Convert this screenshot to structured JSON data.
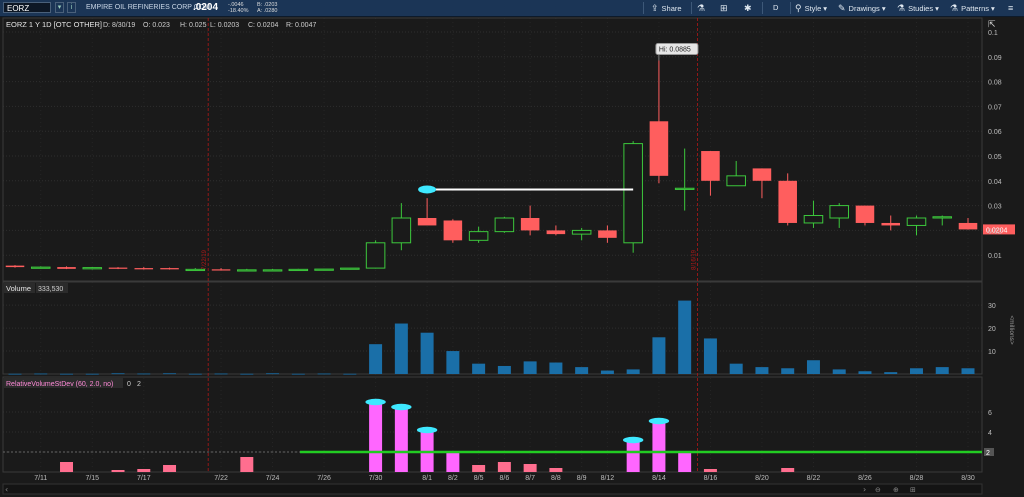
{
  "toolbar": {
    "symbol": "EORZ",
    "company": "EMPIRE OIL REFINERIES CORP COM",
    "last": ".0204",
    "change": "-.0046",
    "change_pct": "-18.40%",
    "bid": "B: .0203",
    "ask": "A: .0280",
    "share_label": "Share",
    "aggregation": "D",
    "style_label": "Style",
    "drawings_label": "Drawings",
    "studies_label": "Studies",
    "patterns_label": "Patterns",
    "icons": [
      "dropdown-icon",
      "info-icon",
      "export-icon",
      "flask-icon",
      "gear-icon",
      "pencil-icon",
      "pin-icon",
      "menu-icon"
    ]
  },
  "ohlc_bar": {
    "title": "EORZ 1 Y 1D [OTC OTHER]",
    "date": "D: 8/30/19",
    "open": "O: 0.023",
    "high": "H: 0.025",
    "low": "L: 0.0203",
    "close": "C: 0.0204",
    "range": "R: 0.0047"
  },
  "price_panel": {
    "hi_label": "Hi: 0.0885",
    "price_tag": "0.0204",
    "axis_ticks": [
      "0.1",
      "0.09",
      "0.08",
      "0.07",
      "0.06",
      "0.05",
      "0.04",
      "0.03",
      "0.02",
      "0.01"
    ],
    "event_markers": [
      "7/22/19",
      "8/16/19"
    ]
  },
  "volume_panel": {
    "label": "Volume",
    "value": "333,530",
    "axis_ticks": [
      "30",
      "20",
      "10"
    ],
    "unit": "<millions>"
  },
  "study_panel": {
    "label": "RelativeVolumeStDev (60, 2.0, no)",
    "value1": "0",
    "value2": "2",
    "axis_ticks": [
      "6",
      "4",
      "2"
    ],
    "level_tag": "2"
  },
  "x_axis": [
    "7/11",
    "7/15",
    "7/17",
    "7/22",
    "7/24",
    "7/26",
    "7/30",
    "8/1",
    "8/2",
    "8/5",
    "8/6",
    "8/7",
    "8/8",
    "8/9",
    "8/12",
    "8/14",
    "8/16",
    "8/20",
    "8/22",
    "8/26",
    "8/28",
    "8/30"
  ],
  "colors": {
    "up": "#3cc83c",
    "down": "#ff5e5e",
    "volume": "#1a6fa8",
    "rvsd": "#ff66ff",
    "level": "#22cc22",
    "highlight": "#3ee8ff"
  },
  "chart_data": {
    "type": "candlestick",
    "dates": [
      "7/10",
      "7/11",
      "7/12",
      "7/15",
      "7/16",
      "7/17",
      "7/18",
      "7/19",
      "7/22",
      "7/23",
      "7/24",
      "7/25",
      "7/26",
      "7/29",
      "7/30",
      "7/31",
      "8/1",
      "8/2",
      "8/5",
      "8/6",
      "8/7",
      "8/8",
      "8/9",
      "8/12",
      "8/13",
      "8/14",
      "8/15",
      "8/16",
      "8/19",
      "8/20",
      "8/21",
      "8/22",
      "8/23",
      "8/26",
      "8/27",
      "8/28",
      "8/29",
      "8/30"
    ],
    "open": [
      0.0058,
      0.0052,
      0.0052,
      0.0045,
      0.005,
      0.0048,
      0.0048,
      0.0043,
      0.0043,
      0.0041,
      0.0041,
      0.0041,
      0.0043,
      0.0044,
      0.0048,
      0.015,
      0.025,
      0.024,
      0.016,
      0.0195,
      0.025,
      0.02,
      0.0185,
      0.02,
      0.015,
      0.064,
      0.037,
      0.052,
      0.038,
      0.045,
      0.04,
      0.023,
      0.025,
      0.03,
      0.023,
      0.022,
      0.025,
      0.023
    ],
    "high": [
      0.006,
      0.0055,
      0.0055,
      0.0052,
      0.0052,
      0.0052,
      0.005,
      0.0048,
      0.0048,
      0.0045,
      0.0045,
      0.0045,
      0.0045,
      0.0046,
      0.016,
      0.031,
      0.033,
      0.0245,
      0.0215,
      0.0255,
      0.03,
      0.022,
      0.021,
      0.022,
      0.056,
      0.0885,
      0.053,
      0.052,
      0.048,
      0.045,
      0.043,
      0.032,
      0.031,
      0.03,
      0.026,
      0.026,
      0.026,
      0.025
    ],
    "low": [
      0.005,
      0.0046,
      0.0044,
      0.0042,
      0.0044,
      0.0042,
      0.0042,
      0.004,
      0.0038,
      0.0038,
      0.0038,
      0.004,
      0.004,
      0.0042,
      0.0046,
      0.012,
      0.023,
      0.015,
      0.015,
      0.019,
      0.018,
      0.018,
      0.016,
      0.015,
      0.011,
      0.039,
      0.028,
      0.034,
      0.038,
      0.033,
      0.022,
      0.021,
      0.021,
      0.022,
      0.02,
      0.018,
      0.022,
      0.0203
    ],
    "close": [
      0.0052,
      0.0052,
      0.0045,
      0.005,
      0.0048,
      0.0043,
      0.0043,
      0.0043,
      0.0041,
      0.0041,
      0.0041,
      0.0043,
      0.0044,
      0.0048,
      0.015,
      0.025,
      0.022,
      0.016,
      0.0195,
      0.025,
      0.02,
      0.0185,
      0.02,
      0.017,
      0.055,
      0.042,
      0.037,
      0.04,
      0.042,
      0.04,
      0.023,
      0.026,
      0.03,
      0.023,
      0.022,
      0.025,
      0.0255,
      0.0204
    ],
    "volume": [
      0.1,
      0.2,
      0.1,
      0.1,
      0.3,
      0.2,
      0.3,
      0.1,
      0.2,
      0.1,
      0.3,
      0.1,
      0.2,
      0.1,
      13,
      22,
      18,
      10,
      4.5,
      3.5,
      5.5,
      5,
      3,
      1.5,
      2,
      16,
      32,
      15.5,
      4.5,
      3,
      2.5,
      6,
      2,
      1.2,
      0.8,
      2.5,
      3,
      2.5
    ],
    "rvsd": [
      0,
      0,
      1,
      0,
      0.2,
      0.3,
      0.7,
      0,
      0,
      1.5,
      0,
      0,
      0,
      0,
      7,
      6.5,
      4.2,
      2,
      0.7,
      1,
      0.8,
      0.4,
      0,
      0,
      3.2,
      5.1,
      2,
      0.3,
      0,
      0,
      0.4,
      0,
      0,
      0,
      0,
      0,
      0,
      0
    ],
    "rvsd_level": 2,
    "annotations": {
      "hi": 0.0885,
      "ray_price": 0.0365,
      "ray_from": "8/1",
      "ray_to": "8/13"
    },
    "ylim_price": [
      0,
      0.1
    ],
    "ylim_volume": [
      0,
      34
    ],
    "ylim_rvsd": [
      0,
      8
    ]
  }
}
